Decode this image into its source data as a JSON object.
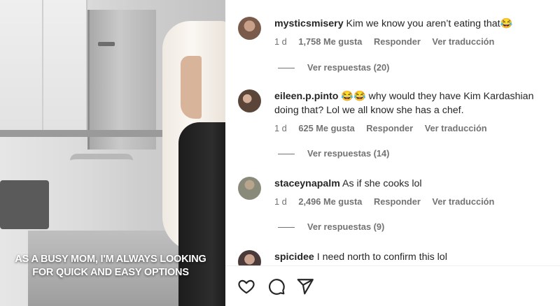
{
  "video": {
    "caption_line1": "AS A BUSY MOM, I'M ALWAYS LOOKING",
    "caption_line2": "FOR QUICK AND EASY OPTIONS"
  },
  "comments": [
    {
      "username": "mysticsmisery",
      "text": "Kim we know you aren’t eating that😂",
      "age": "1 d",
      "likes": "1,758 Me gusta",
      "reply": "Responder",
      "translate": "Ver traducción",
      "view_replies": "Ver respuestas (20)",
      "avatar_color": "#7a5a4a"
    },
    {
      "username": "eileen.p.pinto",
      "text": "😂😂 why would they have Kim Kardashian doing that? Lol we all know she has a chef.",
      "age": "1 d",
      "likes": "625 Me gusta",
      "reply": "Responder",
      "translate": "Ver traducción",
      "view_replies": "Ver respuestas (14)",
      "avatar_color": "#5b4538"
    },
    {
      "username": "staceynapalm",
      "text": "As if she cooks lol",
      "age": "1 d",
      "likes": "2,496 Me gusta",
      "reply": "Responder",
      "translate": "Ver traducción",
      "view_replies": "Ver respuestas (9)",
      "avatar_color": "#8a8a7a"
    },
    {
      "username": "spicidee",
      "text": "I need north to confirm this lol",
      "avatar_color": "#4a3a3a"
    }
  ],
  "actions": {
    "like_icon": "heart-icon",
    "comment_icon": "comment-bubble-icon",
    "share_icon": "paper-plane-icon"
  }
}
